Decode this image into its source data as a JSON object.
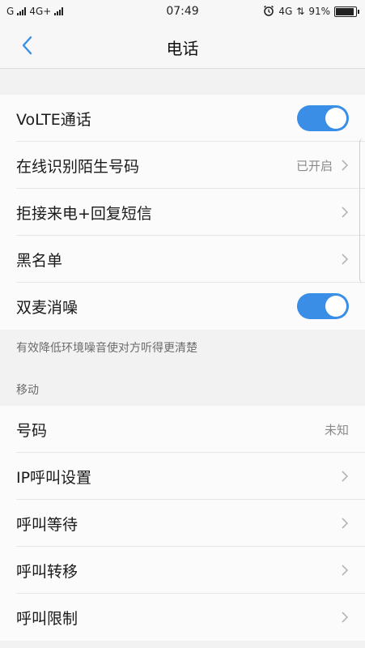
{
  "status_bar": {
    "carrier1": "G",
    "carrier2": "4G+",
    "time": "07:49",
    "network": "4G",
    "battery_percent": "91%",
    "battery_level": 0.91
  },
  "nav": {
    "title": "电话"
  },
  "colors": {
    "accent": "#3a8ee6",
    "background": "#f2f2f2"
  },
  "settings": {
    "volte_label": "VoLTE通话",
    "volte_on": true,
    "stranger_label": "在线识别陌生号码",
    "stranger_value": "已开启",
    "reject_sms_label": "拒接来电+回复短信",
    "blacklist_label": "黑名单",
    "dual_mic_label": "双麦消噪",
    "dual_mic_on": true,
    "dual_mic_hint": "有效降低环境噪音使对方听得更清楚"
  },
  "mobile": {
    "header": "移动",
    "number_label": "号码",
    "number_value": "未知",
    "ip_call_label": "IP呼叫设置",
    "call_waiting_label": "呼叫等待",
    "call_forwarding_label": "呼叫转移",
    "call_barring_label": "呼叫限制"
  }
}
